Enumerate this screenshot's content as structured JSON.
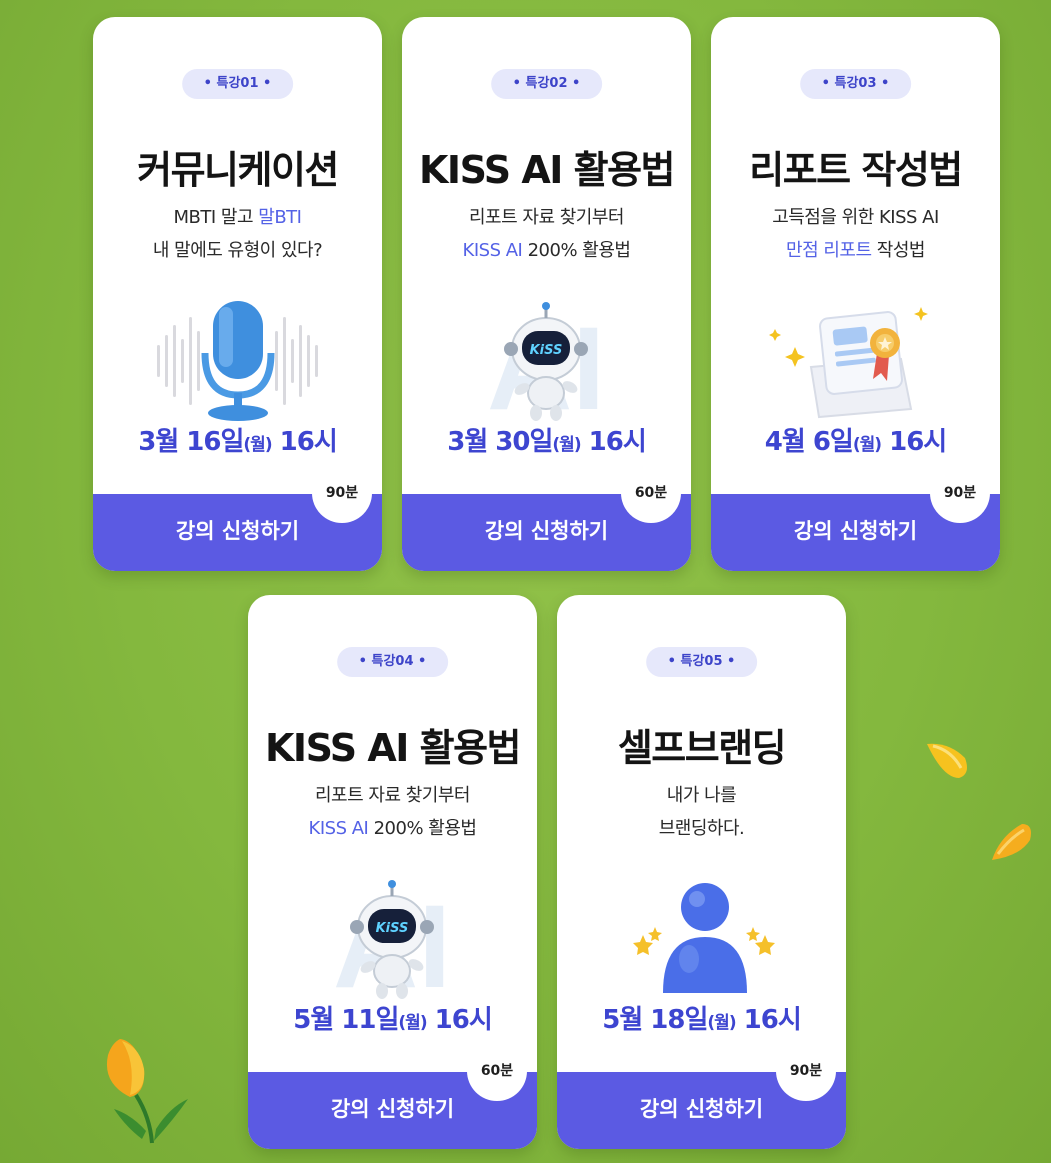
{
  "lectures": [
    {
      "badge": "• 특강01 •",
      "title": "커뮤니케이션",
      "desc_line1": [
        "MBTI 말고 ",
        "말BTI",
        ""
      ],
      "desc_line2": [
        "",
        "",
        "내 말에도 유형이 있다?"
      ],
      "date_main": "3월 16일",
      "date_day": "(월)",
      "date_time": " 16시",
      "duration": "90분",
      "cta": "강의 신청하기",
      "icon": "microphone-icon"
    },
    {
      "badge": "• 특강02 •",
      "title": "KISS AI 활용법",
      "desc_line1": [
        "",
        "",
        "리포트 자료 찾기부터"
      ],
      "desc_line2": [
        "",
        "KISS AI",
        " 200% 활용법"
      ],
      "date_main": "3월 30일",
      "date_day": "(월)",
      "date_time": " 16시",
      "duration": "60분",
      "cta": "강의 신청하기",
      "icon": "robot-icon",
      "watermark": "AI"
    },
    {
      "badge": "• 특강03 •",
      "title": "리포트 작성법",
      "desc_line1": [
        "",
        "",
        "고득점을 위한 KISS AI"
      ],
      "desc_line2": [
        "",
        "만점 리포트",
        " 작성법"
      ],
      "date_main": "4월 6일",
      "date_day": "(월)",
      "date_time": " 16시",
      "duration": "90분",
      "cta": "강의 신청하기",
      "icon": "certificate-icon"
    },
    {
      "badge": "• 특강04 •",
      "title": "KISS AI 활용법",
      "desc_line1": [
        "",
        "",
        "리포트 자료 찾기부터"
      ],
      "desc_line2": [
        "",
        "KISS AI",
        " 200% 활용법"
      ],
      "date_main": "5월 11일",
      "date_day": "(월)",
      "date_time": " 16시",
      "duration": "60분",
      "cta": "강의 신청하기",
      "icon": "robot-icon",
      "watermark": "AI"
    },
    {
      "badge": "• 특강05 •",
      "title": "셀프브랜딩",
      "desc_line1": [
        "",
        "",
        "내가 나를"
      ],
      "desc_line2": [
        "",
        "",
        "브랜딩하다."
      ],
      "date_main": "5월 18일",
      "date_day": "(월)",
      "date_time": " 16시",
      "duration": "90분",
      "cta": "강의 신청하기",
      "icon": "person-star-icon"
    }
  ],
  "colors": {
    "accent": "#5b5ae3",
    "date_text": "#3d45d0",
    "highlight": "#5462e6",
    "background": "#84b83e"
  }
}
